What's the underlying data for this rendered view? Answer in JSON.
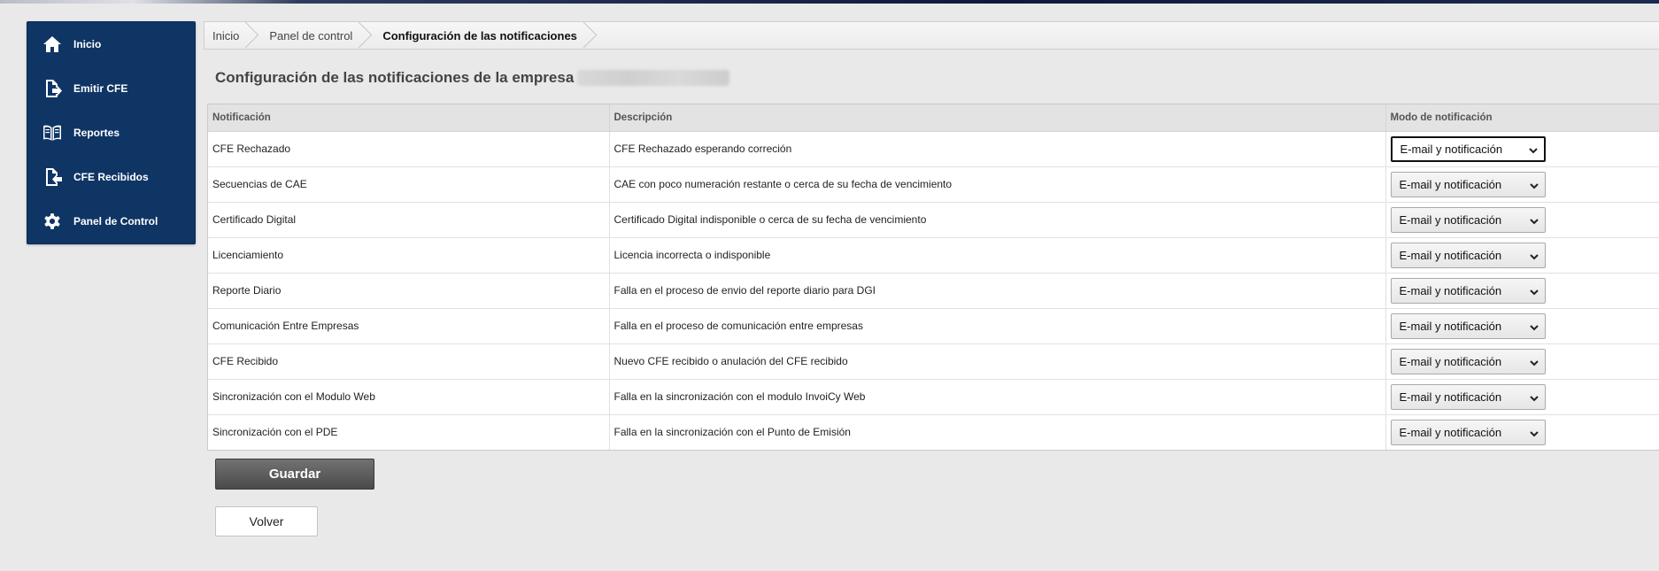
{
  "sidebar": {
    "items": [
      {
        "label": "Inicio",
        "icon": "home-icon"
      },
      {
        "label": "Emitir CFE",
        "icon": "document-export-icon"
      },
      {
        "label": "Reportes",
        "icon": "open-book-icon"
      },
      {
        "label": "CFE Recibidos",
        "icon": "document-import-icon"
      },
      {
        "label": "Panel de Control",
        "icon": "gear-icon"
      }
    ]
  },
  "breadcrumb": {
    "items": [
      "Inicio",
      "Panel de control",
      "Configuración de las notificaciones"
    ]
  },
  "page": {
    "title": "Configuración de las notificaciones de la empresa"
  },
  "table": {
    "headers": [
      "Notificación",
      "Descripción",
      "Modo de notificación"
    ],
    "rows": [
      {
        "notificacion": "CFE Rechazado",
        "descripcion": "CFE Rechazado esperando correción",
        "modo": "E-mail y notificación"
      },
      {
        "notificacion": "Secuencias de CAE",
        "descripcion": "CAE con poco numeración restante o cerca de su fecha de vencimiento",
        "modo": "E-mail y notificación"
      },
      {
        "notificacion": "Certificado Digital",
        "descripcion": "Certificado Digital indisponible o cerca de su fecha de vencimiento",
        "modo": "E-mail y notificación"
      },
      {
        "notificacion": "Licenciamiento",
        "descripcion": "Licencia incorrecta o indisponible",
        "modo": "E-mail y notificación"
      },
      {
        "notificacion": "Reporte Diario",
        "descripcion": "Falla en el proceso de envio del reporte diario para DGI",
        "modo": "E-mail y notificación"
      },
      {
        "notificacion": "Comunicación Entre Empresas",
        "descripcion": "Falla en el proceso de comunicación entre empresas",
        "modo": "E-mail y notificación"
      },
      {
        "notificacion": "CFE Recibido",
        "descripcion": "Nuevo CFE recibido o anulación del CFE recibido",
        "modo": "E-mail y notificación"
      },
      {
        "notificacion": "Sincronización con el Modulo Web",
        "descripcion": "Falla en la sincronización con el modulo InvoiCy Web",
        "modo": "E-mail y notificación"
      },
      {
        "notificacion": "Sincronización con el PDE",
        "descripcion": "Falla en la sincronización con el Punto de Emisión",
        "modo": "E-mail y notificación"
      }
    ]
  },
  "actions": {
    "save_label": "Guardar",
    "back_label": "Volver"
  }
}
